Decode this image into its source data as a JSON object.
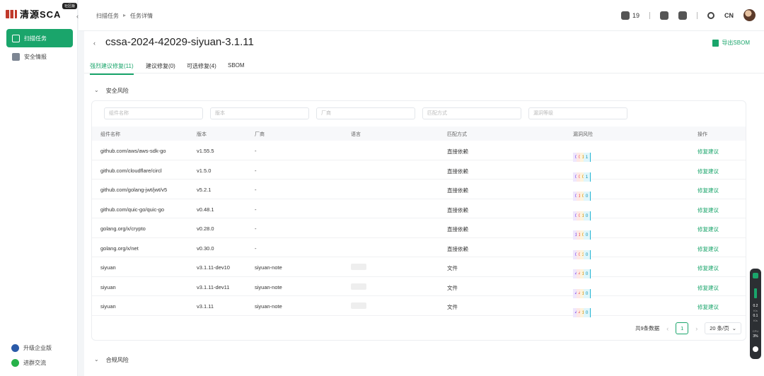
{
  "app": {
    "brand": "清源SCA",
    "badge": "社区版"
  },
  "sidebar": {
    "items": [
      {
        "label": "扫描任务",
        "active": true
      },
      {
        "label": "安全情报",
        "active": false
      }
    ],
    "footer": [
      {
        "label": "升级企业版"
      },
      {
        "label": "进群交流"
      }
    ]
  },
  "header": {
    "breadcrumb": [
      "扫描任务",
      "任务详情"
    ],
    "notification_count": "19",
    "language": "CN"
  },
  "page": {
    "title": "cssa-2024-42029-siyuan-3.1.11",
    "export_label": "导出SBOM",
    "tabs": [
      "强烈建议修复(11)",
      "建议修复(0)",
      "可选修复(4)",
      "SBOM"
    ],
    "sections": {
      "security": "安全风险",
      "compliance": "合规风险"
    }
  },
  "filters": {
    "component": "组件名称",
    "version": "版本",
    "vendor": "厂商",
    "match": "匹配方式",
    "risk": "漏洞等级"
  },
  "table": {
    "columns": [
      "组件名称",
      "版本",
      "厂商",
      "语言",
      "匹配方式",
      "漏洞风险",
      "操作"
    ],
    "rows": [
      {
        "name": "github.com/aws/aws-sdk-go",
        "version": "v1.55.5",
        "vendor": "-",
        "match": "直接依赖",
        "c": "0",
        "h": "0",
        "m": "1",
        "l": "1",
        "action": "修复建议"
      },
      {
        "name": "github.com/cloudflare/circl",
        "version": "v1.5.0",
        "vendor": "-",
        "match": "直接依赖",
        "c": "0",
        "h": "0",
        "m": "0",
        "l": "1",
        "action": "修复建议"
      },
      {
        "name": "github.com/golang-jwt/jwt/v5",
        "version": "v5.2.1",
        "vendor": "-",
        "match": "直接依赖",
        "c": "0",
        "h": "1",
        "m": "0",
        "l": "0",
        "action": "修复建议"
      },
      {
        "name": "github.com/quic-go/quic-go",
        "version": "v0.48.1",
        "vendor": "-",
        "match": "直接依赖",
        "c": "0",
        "h": "0",
        "m": "1",
        "l": "0",
        "action": "修复建议"
      },
      {
        "name": "golang.org/x/crypto",
        "version": "v0.28.0",
        "vendor": "-",
        "match": "直接依赖",
        "c": "1",
        "h": "1",
        "m": "0",
        "l": "0",
        "action": "修复建议"
      },
      {
        "name": "golang.org/x/net",
        "version": "v0.30.0",
        "vendor": "-",
        "match": "直接依赖",
        "c": "0",
        "h": "0",
        "m": "3",
        "l": "0",
        "action": "修复建议"
      },
      {
        "name": "siyuan",
        "version": "v3.1.11-dev10",
        "vendor": "siyuan-note",
        "match": "文件",
        "c": "4",
        "h": "4",
        "m": "1",
        "l": "0",
        "action": "修复建议"
      },
      {
        "name": "siyuan",
        "version": "v3.1.11-dev11",
        "vendor": "siyuan-note",
        "match": "文件",
        "c": "4",
        "h": "4",
        "m": "1",
        "l": "0",
        "action": "修复建议"
      },
      {
        "name": "siyuan",
        "version": "v3.1.11",
        "vendor": "siyuan-note",
        "match": "文件",
        "c": "4",
        "h": "4",
        "m": "1",
        "l": "0",
        "action": "修复建议"
      }
    ]
  },
  "pagination": {
    "total": "共9条数据",
    "current": "1",
    "page_size": "20 条/页"
  },
  "widget": {
    "v1": "0.2",
    "v1u": "K/s",
    "v2": "0.1",
    "v2u": "K/s",
    "cpu": "CPU",
    "cpu_val": "3%"
  },
  "colors": {
    "accent": "#1aa56b",
    "critical": "#7b3fe4",
    "high": "#ef5a4b",
    "medium": "#f4b21b",
    "low": "#22b4d4"
  }
}
